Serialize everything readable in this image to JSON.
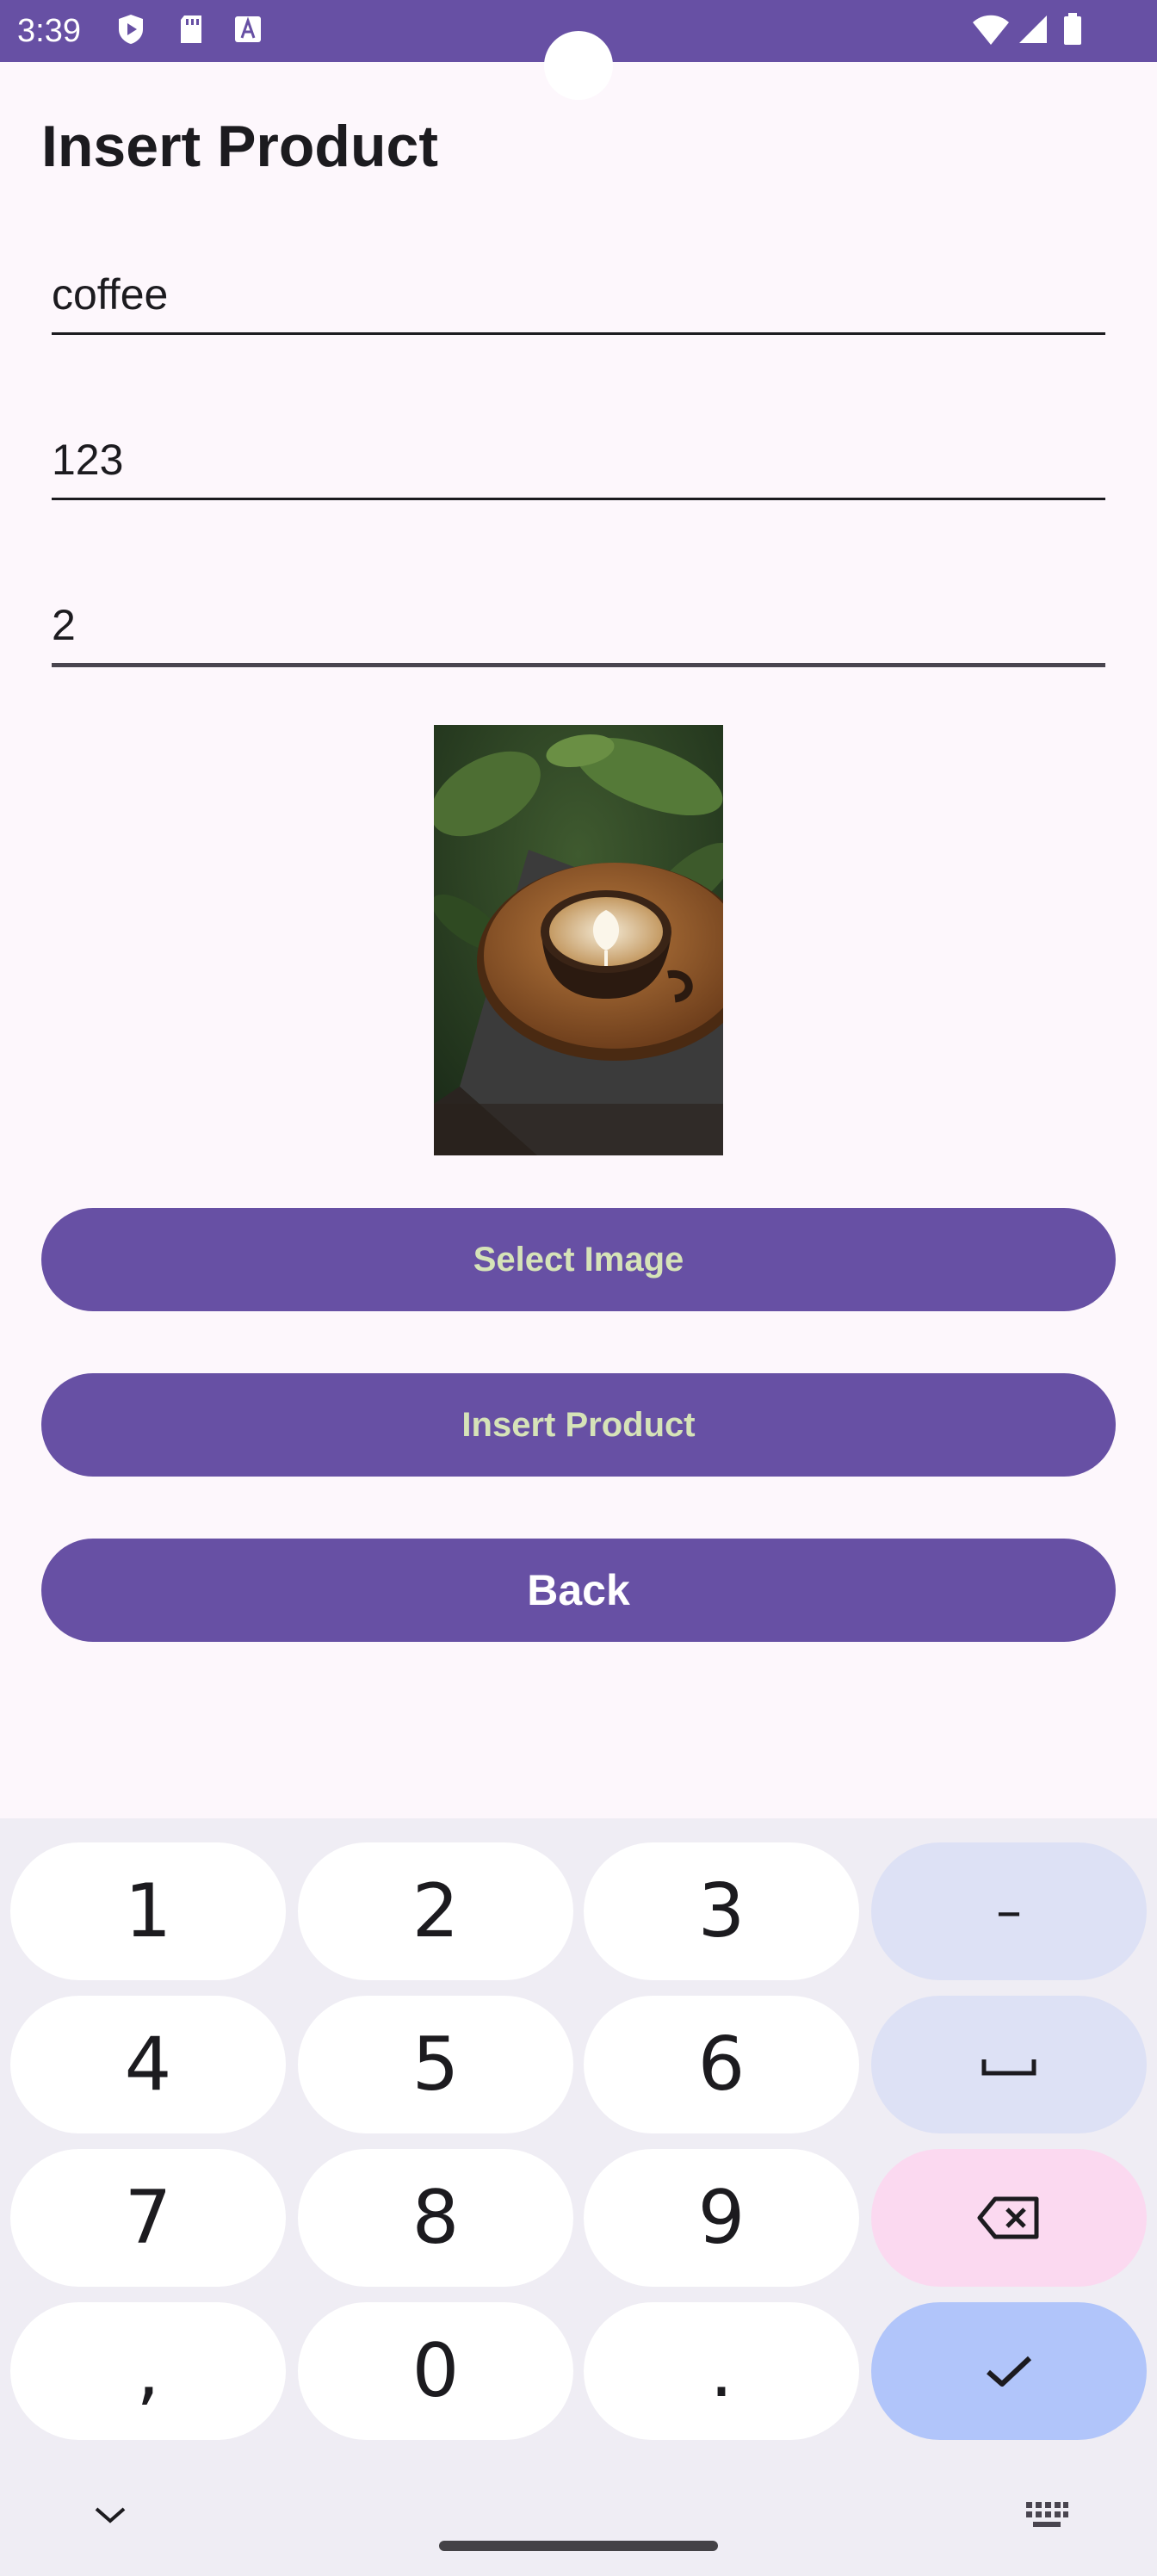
{
  "status_bar": {
    "time": "3:39",
    "icons": [
      "play-protect-icon",
      "sd-card-icon",
      "text-a-icon",
      "wifi-icon",
      "signal-icon",
      "battery-icon"
    ],
    "color": "#6750a4"
  },
  "page": {
    "title": "Insert Product"
  },
  "form": {
    "name_value": "coffee",
    "price_value": "123",
    "quantity_value": "2"
  },
  "image": {
    "subject": "latte-art-coffee-cup"
  },
  "buttons": {
    "select_image": "Select Image",
    "insert_product": "Insert Product",
    "back": "Back"
  },
  "keyboard": {
    "rows": [
      [
        "1",
        "2",
        "3",
        "–"
      ],
      [
        "4",
        "5",
        "6",
        "␣"
      ],
      [
        "7",
        "8",
        "9",
        "⌫"
      ],
      [
        ",",
        "0",
        ".",
        "✓"
      ]
    ]
  },
  "colors": {
    "accent": "#6750a4",
    "background": "#fdf7fc",
    "keyboard_bg": "#efedf4",
    "func_key": "#dde1f5",
    "delete_key": "#fbd9f0",
    "done_key": "#b1c5fa"
  }
}
